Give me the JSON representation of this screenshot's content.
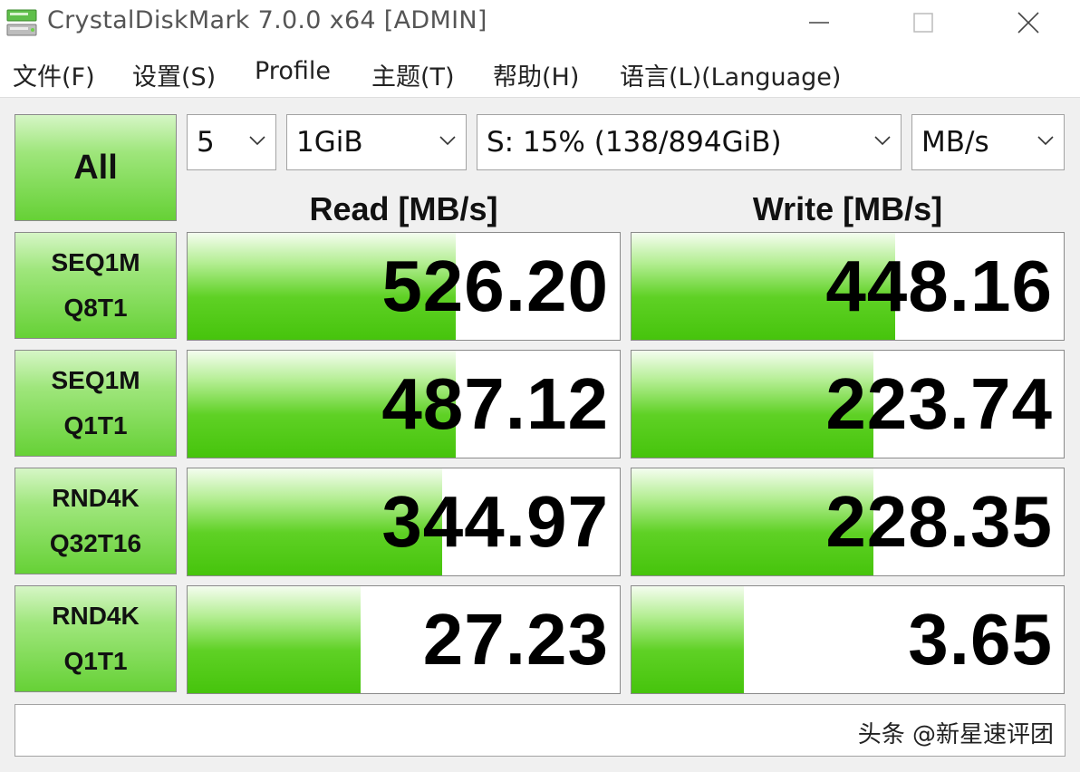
{
  "window": {
    "title": "CrystalDiskMark 7.0.0 x64 [ADMIN]"
  },
  "menu": {
    "file": "文件(F)",
    "settings": "设置(S)",
    "profile": "Profile",
    "theme": "主题(T)",
    "help": "帮助(H)",
    "language": "语言(L)(Language)"
  },
  "controls": {
    "all_label": "All",
    "test_count": "5",
    "test_size": "1GiB",
    "drive": "S: 15% (138/894GiB)",
    "unit": "MB/s"
  },
  "headers": {
    "read": "Read [MB/s]",
    "write": "Write [MB/s]"
  },
  "tests": [
    {
      "line1": "SEQ1M",
      "line2": "Q8T1",
      "read": "526.20",
      "write": "448.16",
      "read_fill": 0.62,
      "write_fill": 0.61
    },
    {
      "line1": "SEQ1M",
      "line2": "Q1T1",
      "read": "487.12",
      "write": "223.74",
      "read_fill": 0.62,
      "write_fill": 0.56
    },
    {
      "line1": "RND4K",
      "line2": "Q32T16",
      "read": "344.97",
      "write": "228.35",
      "read_fill": 0.59,
      "write_fill": 0.56
    },
    {
      "line1": "RND4K",
      "line2": "Q1T1",
      "read": "27.23",
      "write": "3.65",
      "read_fill": 0.4,
      "write_fill": 0.26
    }
  ],
  "comment": "",
  "watermark": "头条 @新星速评团",
  "colors": {
    "bar_green": "#46c40c",
    "button_green": "#66d136"
  }
}
